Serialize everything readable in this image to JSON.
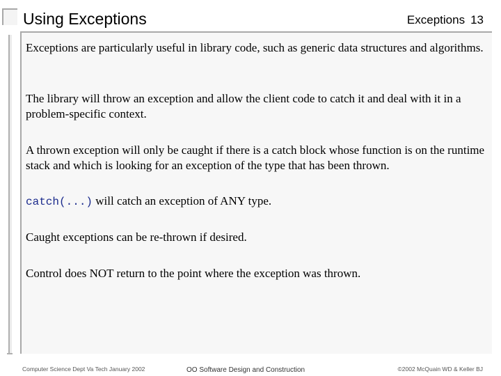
{
  "slide": {
    "title": "Using Exceptions",
    "section_label": "Exceptions",
    "page_number": "13"
  },
  "content": {
    "paragraphs": [
      {
        "text": "Exceptions are particularly useful in library code, such as generic data structures and algorithms."
      },
      {
        "text": "The library will throw an exception and allow the client code to catch it and deal with it in a problem-specific context."
      },
      {
        "text": "A thrown exception will only be caught if there is a catch block whose function is on the runtime stack and which is looking for an exception of the type that has been thrown."
      },
      {
        "code": "catch(...)",
        "text": " will catch an exception of ANY type."
      },
      {
        "text": "Caught exceptions can be re-thrown if desired."
      },
      {
        "text": "Control does NOT return to the point where the exception was thrown."
      }
    ]
  },
  "footer": {
    "left": "Computer Science Dept Va Tech January 2002",
    "center": "OO Software Design and Construction",
    "right": "©2002  McQuain WD & Keller BJ"
  }
}
